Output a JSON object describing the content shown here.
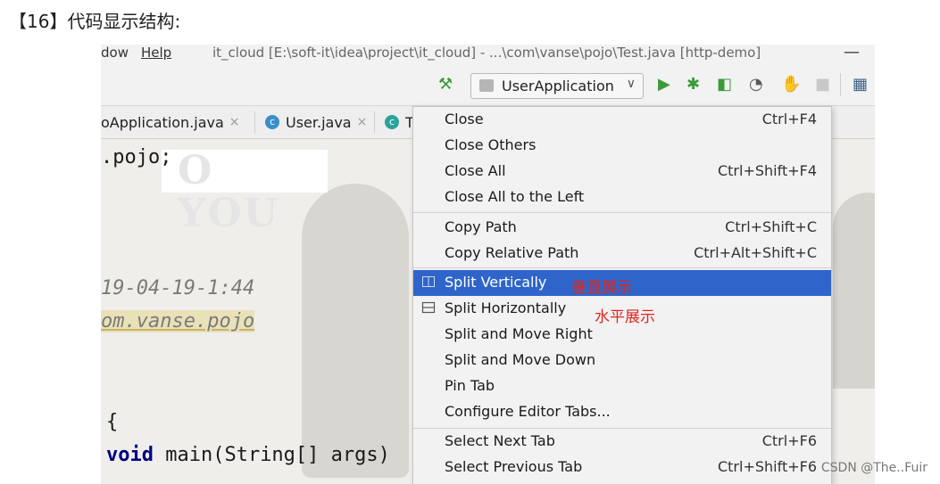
{
  "heading": "【16】代码显示结构:",
  "ide": {
    "menubar": {
      "window_fragment": "dow",
      "help": "Help",
      "title": "it_cloud [E:\\soft-it\\idea\\project\\it_cloud] - ...\\com\\vanse\\pojo\\Test.java [http-demo]"
    },
    "toolbar": {
      "run_config": "UserApplication"
    },
    "tabs": [
      {
        "label": "oApplication.java"
      },
      {
        "label": "User.java"
      },
      {
        "label": "T"
      }
    ],
    "watermark": "O YOU",
    "code_lines": {
      "package_suffix": ".pojo;",
      "date_comment": "19-04-19-1:44",
      "package_ref": "om.vanse.pojo",
      "brace": "{",
      "main_kw": "void",
      "main_rest": " main(String[] args)"
    }
  },
  "context_menu": {
    "items": [
      {
        "label": "Close",
        "shortcut": "Ctrl+F4"
      },
      {
        "label": "Close Others",
        "shortcut": ""
      },
      {
        "label": "Close All",
        "shortcut": "Ctrl+Shift+F4"
      },
      {
        "label": "Close All to the Left",
        "shortcut": ""
      },
      {
        "label": "Copy Path",
        "shortcut": "Ctrl+Shift+C"
      },
      {
        "label": "Copy Relative Path",
        "shortcut": "Ctrl+Alt+Shift+C"
      },
      {
        "label": "Split Vertically",
        "shortcut": "",
        "selected": true
      },
      {
        "label": "Split Horizontally",
        "shortcut": ""
      },
      {
        "label": "Split and Move Right",
        "shortcut": ""
      },
      {
        "label": "Split and Move Down",
        "shortcut": ""
      },
      {
        "label": "Pin Tab",
        "shortcut": ""
      },
      {
        "label": "Configure Editor Tabs...",
        "shortcut": ""
      },
      {
        "label": "Select Next Tab",
        "shortcut": "Ctrl+F6"
      },
      {
        "label": "Select Previous Tab",
        "shortcut": "Ctrl+Shift+F6"
      }
    ]
  },
  "annotations": {
    "vertical": "垂直展示",
    "horizontal": "水平展示"
  },
  "credit": "CSDN @The..Fuir",
  "colors": {
    "selection": "#2f65ca",
    "annotation": "#e2261d",
    "run_green": "#3a9b3a"
  }
}
